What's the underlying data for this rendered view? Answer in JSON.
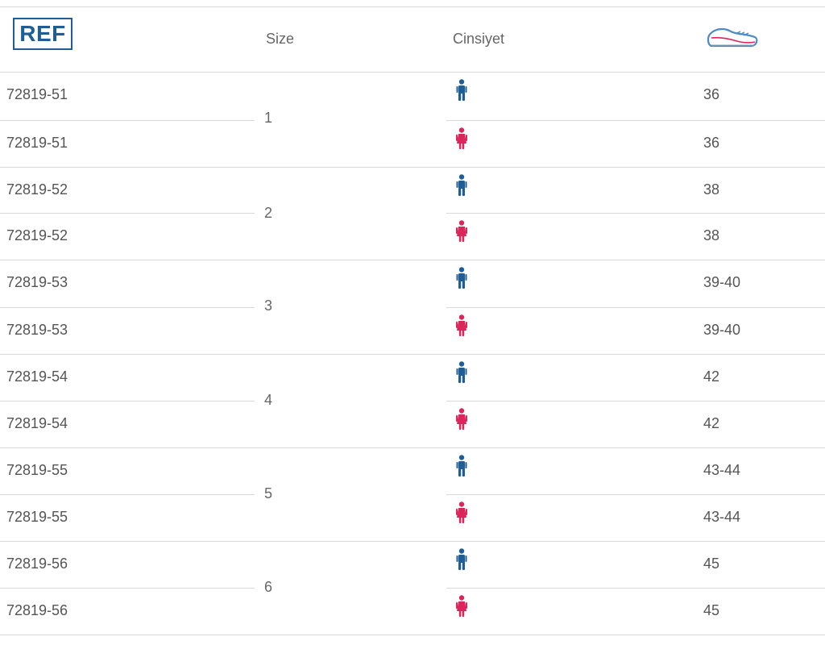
{
  "header": {
    "ref_label": "REF",
    "size_label": "Size",
    "gender_label": "Cinsiyet",
    "shoe_size_icon": "shoe-icon"
  },
  "groups": [
    {
      "size": "1",
      "rows": [
        {
          "ref": "72819-51",
          "gender": "male",
          "shoe_size": "36"
        },
        {
          "ref": "72819-51",
          "gender": "female",
          "shoe_size": "36"
        }
      ]
    },
    {
      "size": "2",
      "rows": [
        {
          "ref": "72819-52",
          "gender": "male",
          "shoe_size": "38"
        },
        {
          "ref": "72819-52",
          "gender": "female",
          "shoe_size": "38"
        }
      ]
    },
    {
      "size": "3",
      "rows": [
        {
          "ref": "72819-53",
          "gender": "male",
          "shoe_size": "39-40"
        },
        {
          "ref": "72819-53",
          "gender": "female",
          "shoe_size": "39-40"
        }
      ]
    },
    {
      "size": "4",
      "rows": [
        {
          "ref": "72819-54",
          "gender": "male",
          "shoe_size": "42"
        },
        {
          "ref": "72819-54",
          "gender": "female",
          "shoe_size": "42"
        }
      ]
    },
    {
      "size": "5",
      "rows": [
        {
          "ref": "72819-55",
          "gender": "male",
          "shoe_size": "43-44"
        },
        {
          "ref": "72819-55",
          "gender": "female",
          "shoe_size": "43-44"
        }
      ]
    },
    {
      "size": "6",
      "rows": [
        {
          "ref": "72819-56",
          "gender": "male",
          "shoe_size": "45"
        },
        {
          "ref": "72819-56",
          "gender": "female",
          "shoe_size": "45"
        }
      ]
    }
  ],
  "colors": {
    "brand_blue": "#1f5d96",
    "male_blue": "#1f5d96",
    "female_pink": "#d9265b",
    "line": "#d9d9d9"
  }
}
